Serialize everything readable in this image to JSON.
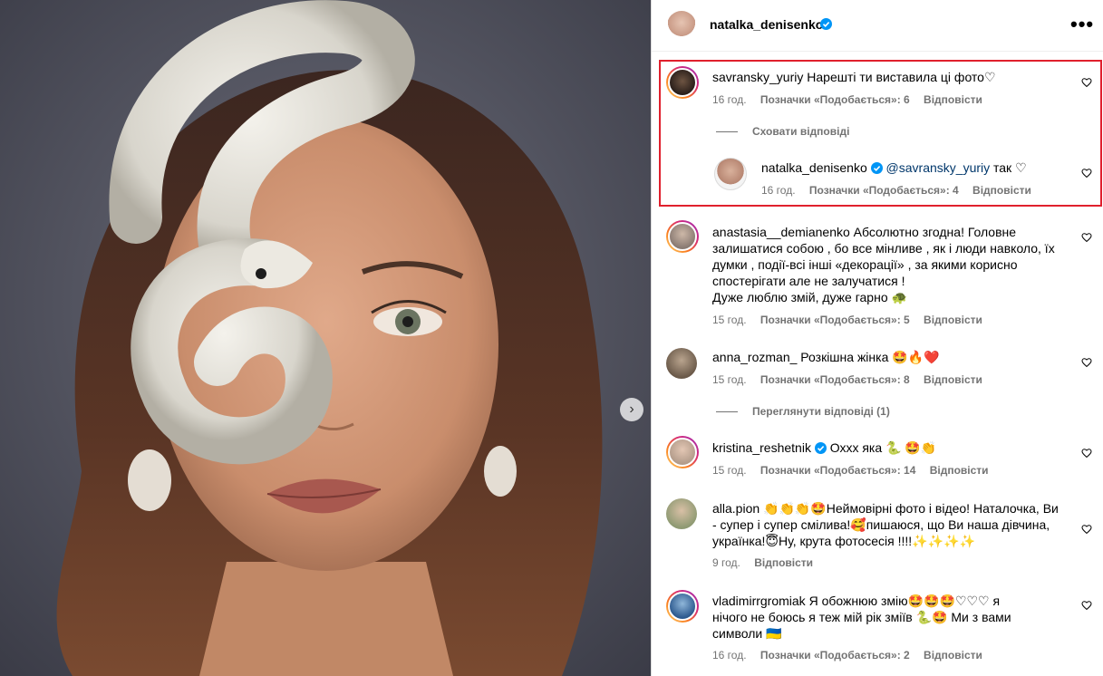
{
  "post": {
    "author": "natalka_denisenko",
    "more_icon": "•••",
    "next_icon": "›"
  },
  "comments": [
    {
      "user": "savransky_yuriy",
      "text": "Нарешті ти виставила ці фото♡",
      "time": "16 год.",
      "likes": "Позначки «Подобається»: 6",
      "reply": "Відповісти",
      "toggle": "Сховати відповіді",
      "replies": [
        {
          "user": "natalka_denisenko",
          "mention": "@savransky_yuriy",
          "text": " так ♡",
          "time": "16 год.",
          "likes": "Позначки «Подобається»: 4",
          "reply": "Відповісти"
        }
      ]
    },
    {
      "user": "anastasia__demianenko",
      "text_lines": [
        "Абсолютно згодна! Головне",
        "залишатися собою , бо все мінливе , як і люди навколо, їх",
        "думки , події-всі інші «декорації» , за якими корисно",
        "спостерігати але не залучатися !",
        "Дуже люблю змій, дуже гарно 🐢"
      ],
      "time": "15 год.",
      "likes": "Позначки «Подобається»: 5",
      "reply": "Відповісти"
    },
    {
      "user": "anna_rozman_",
      "text": "Розкішна жінка 🤩🔥❤️",
      "time": "15 год.",
      "likes": "Позначки «Подобається»: 8",
      "reply": "Відповісти",
      "toggle": "Переглянути відповіді (1)"
    },
    {
      "user": "kristina_reshetnik",
      "text": "Оххх яка 🐍 🤩👏",
      "time": "15 год.",
      "likes": "Позначки «Подобається»: 14",
      "reply": "Відповісти"
    },
    {
      "user": "alla.pion",
      "text_lines": [
        "👏👏👏🤩Неймовірні фото і відео! Наталочка, Ви",
        "- супер і супер смілива!🥰пишаюся, що Ви наша дівчина,",
        "українка!😇Ну, крута фотосесія !!!!✨✨✨✨"
      ],
      "time": "9 год.",
      "reply": "Відповісти"
    },
    {
      "user": "vladimirrgromiak",
      "text_lines": [
        "Я обожнюю змію🤩🤩🤩♡♡♡ я",
        "нічого не боюсь я теж мій рік зміїв 🐍🤩 Ми з вами",
        "символи 🇺🇦"
      ],
      "time": "16 год.",
      "likes": "Позначки «Подобається»: 2",
      "reply": "Відповісти"
    }
  ],
  "colors": {
    "verified": "#0095f6",
    "highlight": "#e0202d",
    "meta": "#737373",
    "mention": "#00376b"
  }
}
